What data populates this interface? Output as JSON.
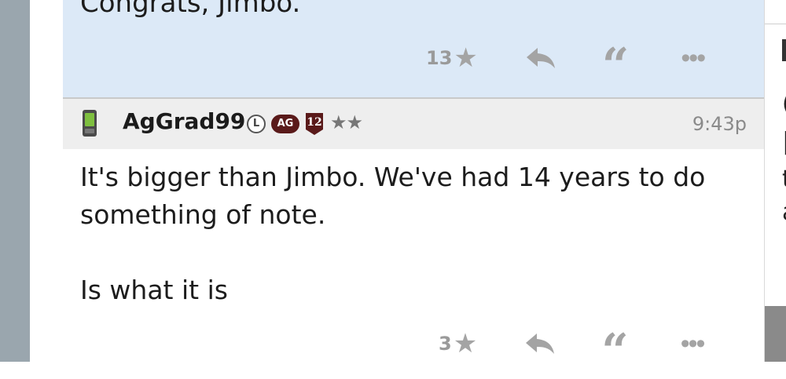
{
  "previous_post": {
    "text": "Congrats, Jimbo.",
    "like_count": "13",
    "star_icon": "★",
    "reply_icon": "reply-arrow",
    "quote_icon": "“",
    "more_icon": "•••"
  },
  "post": {
    "username": "AgGrad99",
    "badge_l": "L",
    "badge_ag": "AG",
    "badge_12": "12",
    "rank_stars": "★★",
    "time": "9:43p",
    "body_line_1": "It's bigger than Jimbo. We've had 14 years to do",
    "body_line_2": "something of note.",
    "body_line_3": "Is what it is",
    "like_count": "3",
    "star_icon": "★",
    "quote_icon": "“",
    "more_icon": "•••"
  },
  "right_fragments": [
    "(",
    "|",
    "t",
    "a"
  ],
  "colors": {
    "highlight_bg": "#dce9f7",
    "header_bg": "#eeeeee",
    "action_grey": "#a4a4a4",
    "badge_maroon": "#5a1a1a",
    "left_rail": "#9aa6ae"
  }
}
